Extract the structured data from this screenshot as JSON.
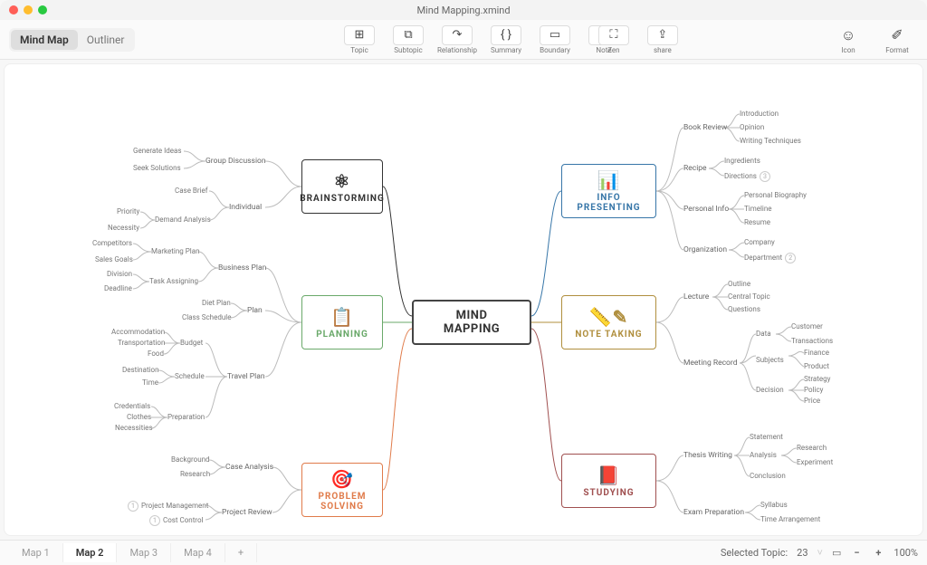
{
  "window": {
    "title": "Mind Mapping.xmind"
  },
  "view_modes": {
    "mindmap": "Mind Map",
    "outliner": "Outliner",
    "active": "mindmap"
  },
  "toolbar": {
    "topic": "Topic",
    "subtopic": "Subtopic",
    "relationship": "Relationship",
    "summary": "Summary",
    "boundary": "Boundary",
    "note": "Note",
    "zen": "Zen",
    "share": "share",
    "icon": "Icon",
    "format": "Format"
  },
  "central": {
    "label": "MIND MAPPING"
  },
  "branches": {
    "brainstorming": {
      "label": "BRAINSTORMING",
      "icon": "⚛",
      "children": [
        {
          "label": "Group Discussion",
          "children": [
            {
              "label": "Generate Ideas"
            },
            {
              "label": "Seek Solutions"
            }
          ]
        },
        {
          "label": "Individual",
          "children": [
            {
              "label": "Case Brief"
            },
            {
              "label": "Demand Analysis",
              "children": [
                {
                  "label": "Priority"
                },
                {
                  "label": "Necessity"
                }
              ]
            }
          ]
        }
      ]
    },
    "planning": {
      "label": "PLANNING",
      "icon": "📋",
      "children": [
        {
          "label": "Business Plan",
          "children": [
            {
              "label": "Marketing Plan",
              "children": [
                {
                  "label": "Competitors"
                },
                {
                  "label": "Sales Goals"
                }
              ]
            },
            {
              "label": "Task Assigning",
              "children": [
                {
                  "label": "Division"
                },
                {
                  "label": "Deadline"
                }
              ]
            }
          ]
        },
        {
          "label": "Plan",
          "children": [
            {
              "label": "Diet Plan"
            },
            {
              "label": "Class Schedule"
            }
          ]
        },
        {
          "label": "Travel Plan",
          "children": [
            {
              "label": "Budget",
              "children": [
                {
                  "label": "Accommodation"
                },
                {
                  "label": "Transportation"
                },
                {
                  "label": "Food"
                }
              ]
            },
            {
              "label": "Schedule",
              "children": [
                {
                  "label": "Destination"
                },
                {
                  "label": "Time"
                }
              ]
            },
            {
              "label": "Preparation",
              "children": [
                {
                  "label": "Credentials"
                },
                {
                  "label": "Clothes"
                },
                {
                  "label": "Necessities"
                }
              ]
            }
          ]
        }
      ]
    },
    "problem_solving": {
      "label": "PROBLEM SOLVING",
      "icon": "🎯",
      "children": [
        {
          "label": "Case Analysis",
          "children": [
            {
              "label": "Background"
            },
            {
              "label": "Research"
            }
          ]
        },
        {
          "label": "Project Review",
          "children": [
            {
              "label": "Project Management",
              "badge": "1"
            },
            {
              "label": "Cost Control",
              "badge": "1"
            }
          ]
        }
      ]
    },
    "info_presenting": {
      "label": "INFO PRESENTING",
      "icon": "📊",
      "children": [
        {
          "label": "Book Review",
          "children": [
            {
              "label": "Introduction"
            },
            {
              "label": "Opinion"
            },
            {
              "label": "Writing Techniques"
            }
          ]
        },
        {
          "label": "Recipe",
          "children": [
            {
              "label": "Ingredients"
            },
            {
              "label": "Directions",
              "badge": "3"
            }
          ]
        },
        {
          "label": "Personal Info",
          "children": [
            {
              "label": "Personal Biography"
            },
            {
              "label": "Timeline"
            },
            {
              "label": "Resume"
            }
          ]
        },
        {
          "label": "Organization",
          "children": [
            {
              "label": "Company"
            },
            {
              "label": "Department",
              "badge": "2"
            }
          ]
        }
      ]
    },
    "note_taking": {
      "label": "NOTE TAKING",
      "icon": "📏✎",
      "children": [
        {
          "label": "Lecture",
          "children": [
            {
              "label": "Outline"
            },
            {
              "label": "Central Topic"
            },
            {
              "label": "Questions"
            }
          ]
        },
        {
          "label": "Meeting Record",
          "children": [
            {
              "label": "Data",
              "children": [
                {
                  "label": "Customer"
                },
                {
                  "label": "Transactions"
                }
              ]
            },
            {
              "label": "Subjects",
              "children": [
                {
                  "label": "Finance"
                },
                {
                  "label": "Product"
                }
              ]
            },
            {
              "label": "Decision",
              "children": [
                {
                  "label": "Strategy"
                },
                {
                  "label": "Policy"
                },
                {
                  "label": "Price"
                }
              ]
            }
          ]
        }
      ]
    },
    "studying": {
      "label": "STUDYING",
      "icon": "📕",
      "children": [
        {
          "label": "Thesis Writing",
          "children": [
            {
              "label": "Statement"
            },
            {
              "label": "Analysis",
              "children": [
                {
                  "label": "Research"
                },
                {
                  "label": "Experiment"
                }
              ]
            },
            {
              "label": "Conclusion"
            }
          ]
        },
        {
          "label": "Exam Preparation",
          "children": [
            {
              "label": "Syllabus"
            },
            {
              "label": "Time Arrangement"
            }
          ]
        }
      ]
    }
  },
  "footer": {
    "tabs": [
      "Map 1",
      "Map 2",
      "Map 3",
      "Map 4"
    ],
    "active_tab": 1,
    "selected_label": "Selected Topic:",
    "selected_count": "23",
    "zoom": "100%"
  },
  "chart_data": {
    "type": "mindmap",
    "title": "MIND MAPPING",
    "root": "MIND MAPPING",
    "left_branches": [
      "BRAINSTORMING",
      "PLANNING",
      "PROBLEM SOLVING"
    ],
    "right_branches": [
      "INFO PRESENTING",
      "NOTE TAKING",
      "STUDYING"
    ]
  }
}
